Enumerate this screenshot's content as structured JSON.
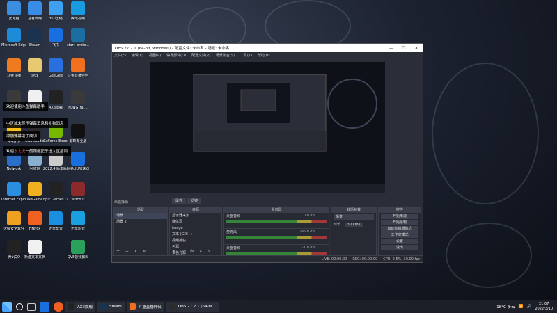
{
  "desktop": {
    "icons": [
      {
        "label": "此电脑",
        "color": "#3b8fe0"
      },
      {
        "label": "Microsoft Edge",
        "color": "#1e8bd8"
      },
      {
        "label": "斗鱼直播",
        "color": "#f07a20"
      },
      {
        "label": "",
        "color": "#3a3a3a"
      },
      {
        "label": "QQ音乐",
        "color": "#f4c21a"
      },
      {
        "label": "Network",
        "color": "#2a6fc8"
      },
      {
        "label": "Internet Explorer",
        "color": "#2a8fe0"
      },
      {
        "label": "火绒安全软件",
        "color": "#f0a020"
      },
      {
        "label": "腾讯QQ",
        "color": "#222222"
      },
      {
        "label": "基鲁师网",
        "color": "#3a8de6"
      },
      {
        "label": "Steam",
        "color": "#1a3350"
      },
      {
        "label": "游戏",
        "color": "#e8c870"
      },
      {
        "label": "新建文本文档",
        "color": "#f0f0f0"
      },
      {
        "label": "OBS Studio",
        "color": "#2b2b2b"
      },
      {
        "label": "回收站",
        "color": "#8ab0d0"
      },
      {
        "label": "WeGame",
        "color": "#f0b020"
      },
      {
        "label": "Firefox",
        "color": "#f06020"
      },
      {
        "label": "新建文本文档",
        "color": "#f0f0f0"
      },
      {
        "label": "360压缩",
        "color": "#3ea0f0"
      },
      {
        "label": "飞书",
        "color": "#1a6fe0"
      },
      {
        "label": "GeeGee",
        "color": "#2a6fe0"
      },
      {
        "label": "AX3旗舰",
        "color": "#222222"
      },
      {
        "label": "GeForce Experience",
        "color": "#76b900"
      },
      {
        "label": "2022.4.版本版本",
        "color": "#cccccc"
      },
      {
        "label": "Epic Games Launcher",
        "color": "#222222"
      },
      {
        "label": "迅雷影音",
        "color": "#1a8fe0"
      },
      {
        "label": "腾讯视频",
        "color": "#1a9be0"
      },
      {
        "label": "start_proto...",
        "color": "#1a6fa0"
      },
      {
        "label": "斗鱼直播伴侣",
        "color": "#f07020"
      },
      {
        "label": "FUNGTrai...",
        "color": "#3a3a3a"
      },
      {
        "label": "剪映专业版",
        "color": "#111111"
      },
      {
        "label": "网易UU加速器",
        "color": "#1a6fe0"
      },
      {
        "label": "Witch It",
        "color": "#8a2a2a"
      },
      {
        "label": "迅雷影音",
        "color": "#1a9fe0"
      },
      {
        "label": "QVE音频剪辑",
        "color": "#2aa05a"
      }
    ],
    "notifications": [
      {
        "text": "欢迎使用斗鱼弹幕助手"
      },
      {
        "text": "中区域未显示弹幕消息和礼物消息"
      },
      {
        "text": "添加弹幕助手成功"
      },
      {
        "prefix": "欢迎",
        "highlight": "东北虎",
        "suffix": "一般照耀犯子进入直播间"
      }
    ]
  },
  "obs": {
    "title": "OBS 27.2.1 (64-bit, windows) - 配置文件: 未命名 - 场景: 未命名",
    "minimize": "—",
    "maximize": "☐",
    "close": "✕",
    "menu": [
      "文件(F)",
      "编辑(E)",
      "视图(V)",
      "停靠部件(D)",
      "配置文件(P)",
      "场景集合(S)",
      "工具(T)",
      "帮助(H)"
    ],
    "scene_label": "未选择源",
    "preview_tabs": [
      "属性",
      "滤镜"
    ],
    "docks": {
      "scenes": {
        "header": "场景",
        "items": [
          "场景",
          "场景 2"
        ],
        "footer": "+ − ∧ ∨"
      },
      "sources": {
        "header": "来源",
        "items": [
          "显示器采集",
          "媒体源",
          "image",
          "文本 (GDI+)",
          "视频捕获",
          "色源",
          "多色光源"
        ],
        "footer": "+ − ⚙ ∧ ∨"
      },
      "mixer": {
        "header": "混音器",
        "channels": [
          {
            "name": "桌面音频",
            "db": "0.0 dB"
          },
          {
            "name": "麦克风",
            "db": "-96.0 dB"
          },
          {
            "name": "桌面音频",
            "db": "-1.0 dB"
          }
        ]
      },
      "transitions": {
        "header": "转场特效",
        "type": "渐变",
        "duration_label": "时长",
        "duration": "300 ms"
      },
      "controls": {
        "header": "控件",
        "buttons": [
          "开始推流",
          "开始录制",
          "启动虚拟摄像机",
          "工作室模式",
          "设置",
          "退出"
        ]
      }
    },
    "status": {
      "live": "LIVE: 00:00:00",
      "rec": "REC: 00:00:00",
      "cpu": "CPU: 2.5%, 30.00 fps"
    }
  },
  "taskbar": {
    "tasks": [
      {
        "label": "AX3旗舰",
        "color": "#222222"
      },
      {
        "label": "Steam",
        "color": "#1a3350"
      },
      {
        "label": "斗鱼直播伴侣",
        "color": "#f07020"
      },
      {
        "label": "OBS 27.2.1 (64-bi...",
        "color": "#2b2b2b"
      }
    ],
    "weather": "18°C 多云",
    "time": "21:07",
    "date": "2022/3/10"
  }
}
